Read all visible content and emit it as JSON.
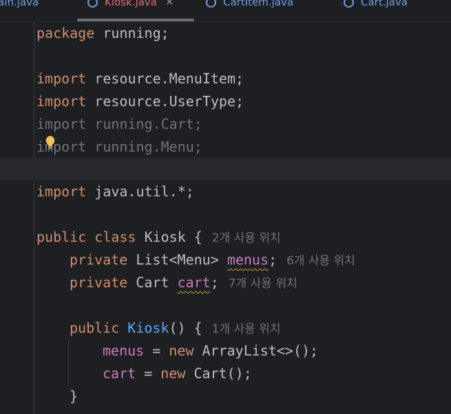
{
  "tabs": [
    {
      "label": "lain.java",
      "active": false
    },
    {
      "label": "Kiosk.java",
      "active": true
    },
    {
      "label": "CartItem.java",
      "active": false
    },
    {
      "label": "Cart.java",
      "active": false
    }
  ],
  "code": {
    "package": {
      "kw": "package",
      "name": "running;"
    },
    "import1": {
      "kw": "import",
      "path": "resource.MenuItem;"
    },
    "import2": {
      "kw": "import",
      "path": "resource.UserType;"
    },
    "import3": {
      "kw": "import",
      "path": "running.Cart;"
    },
    "import4": {
      "kw": "import",
      "path": "running.Menu;"
    },
    "import5": {
      "kw": "import",
      "path": "java.util.*;"
    },
    "class_decl": {
      "kw1": "public",
      "kw2": "class",
      "name": "Kiosk {",
      "hint": "2개 사용 위치"
    },
    "field1": {
      "kw": "private",
      "type": "List<Menu>",
      "name": "menus",
      "end": ";",
      "hint": "6개 사용 위치"
    },
    "field2": {
      "kw": "private",
      "type": "Cart",
      "name": "cart",
      "end": ";",
      "hint": "7개 사용 위치"
    },
    "ctor": {
      "kw": "public",
      "name": "Kiosk",
      "rest": "() {",
      "hint": "1개 사용 위치"
    },
    "assign1": {
      "field": "menus",
      "op": " = ",
      "kw": "new",
      "rest": " ArrayList<>();"
    },
    "assign2": {
      "field": "cart",
      "op": " = ",
      "kw": "new",
      "rest": " Cart();"
    },
    "close_brace": "}"
  },
  "icons": {
    "bulb": "lightbulb-icon",
    "file": "java-class-icon",
    "close": "close-icon"
  }
}
